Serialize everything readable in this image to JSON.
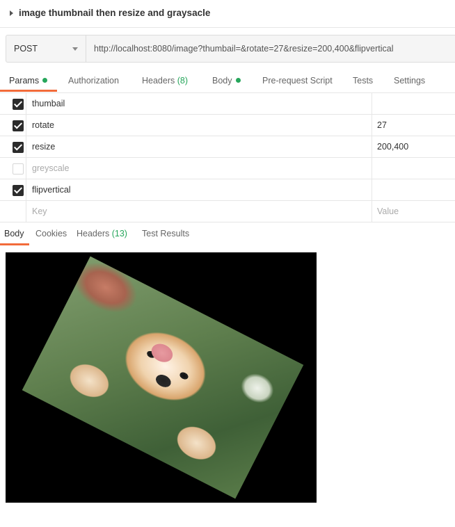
{
  "request": {
    "name": "image thumbnail then resize and graysacle",
    "method": "POST",
    "url": "http://localhost:8080/image?thumbail=&rotate=27&resize=200,400&flipvertical"
  },
  "request_tabs": [
    {
      "label": "Params",
      "dot": true,
      "active": true
    },
    {
      "label": "Authorization"
    },
    {
      "label": "Headers",
      "count": "(8)"
    },
    {
      "label": "Body",
      "dot": true
    },
    {
      "label": "Pre-request Script"
    },
    {
      "label": "Tests"
    },
    {
      "label": "Settings"
    }
  ],
  "params": [
    {
      "key": "thumbail",
      "value": "",
      "checked": true
    },
    {
      "key": "rotate",
      "value": "27",
      "checked": true
    },
    {
      "key": "resize",
      "value": "200,400",
      "checked": true
    },
    {
      "key": "greyscale",
      "value": "",
      "checked": false
    },
    {
      "key": "flipvertical",
      "value": "",
      "checked": true
    }
  ],
  "params_placeholder": {
    "key": "Key",
    "value": "Value"
  },
  "response_tabs": [
    {
      "label": "Body",
      "active": true
    },
    {
      "label": "Cookies"
    },
    {
      "label": "Headers",
      "count": "(13)"
    },
    {
      "label": "Test Results"
    }
  ],
  "colors": {
    "accent": "#f26b3a",
    "status_green": "#26a65b"
  },
  "response_image": {
    "rotation_deg": 27,
    "subject": "corgi puppy upside down"
  }
}
